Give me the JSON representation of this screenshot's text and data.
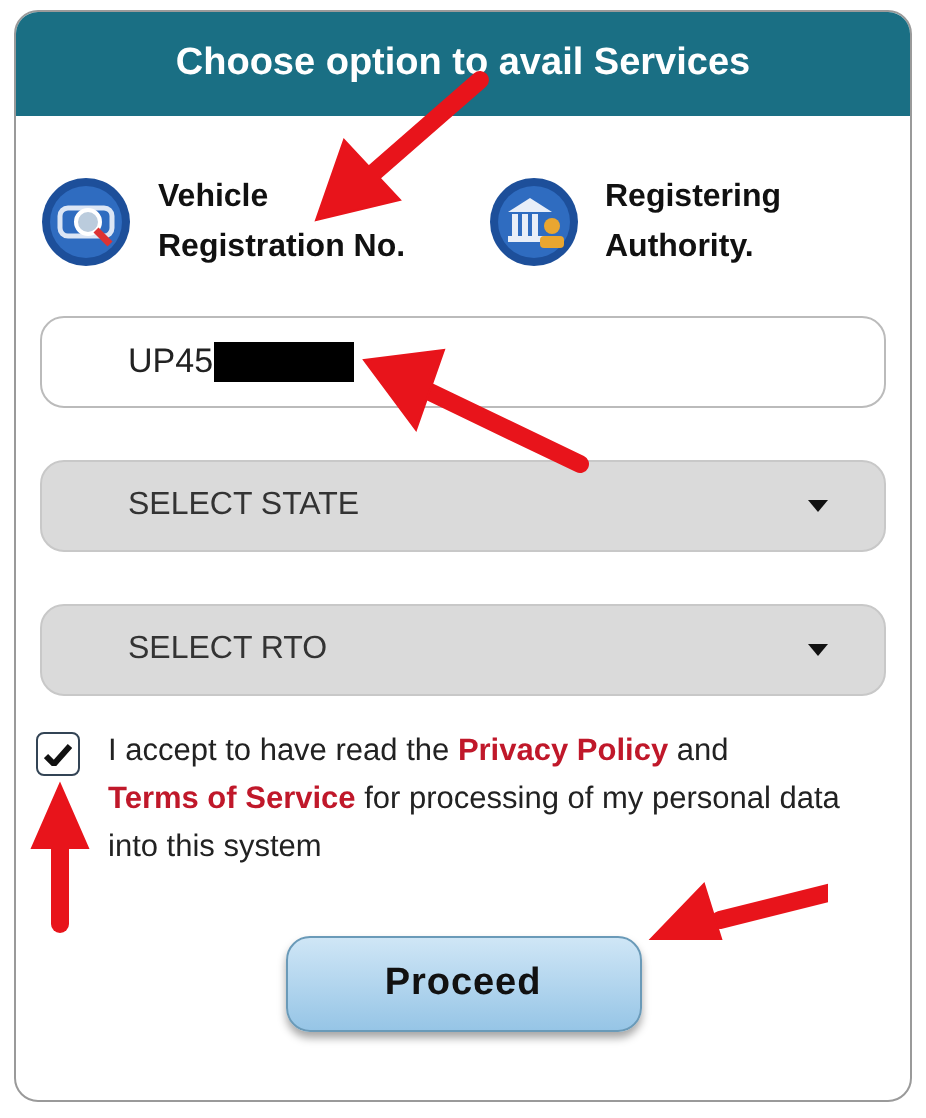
{
  "header": {
    "title": "Choose option to avail Services"
  },
  "options": [
    {
      "label": "Vehicle Registration No.",
      "kind": "vehicle"
    },
    {
      "label": "Registering Authority.",
      "kind": "authority"
    }
  ],
  "registration_field": {
    "value": "UP45",
    "redacted": true
  },
  "selects": [
    {
      "label": "SELECT STATE"
    },
    {
      "label": "SELECT RTO"
    }
  ],
  "consent": {
    "checked": true,
    "parts": [
      {
        "text": "I accept to have read the",
        "kind": "plain"
      },
      {
        "text": "Privacy Policy",
        "kind": "link"
      },
      {
        "text": "and",
        "kind": "plain"
      },
      {
        "text": "Terms of Service",
        "kind": "link"
      },
      {
        "text": "for processing of my personal data into this system",
        "kind": "plain"
      }
    ]
  },
  "button": {
    "label": "Proceed"
  }
}
